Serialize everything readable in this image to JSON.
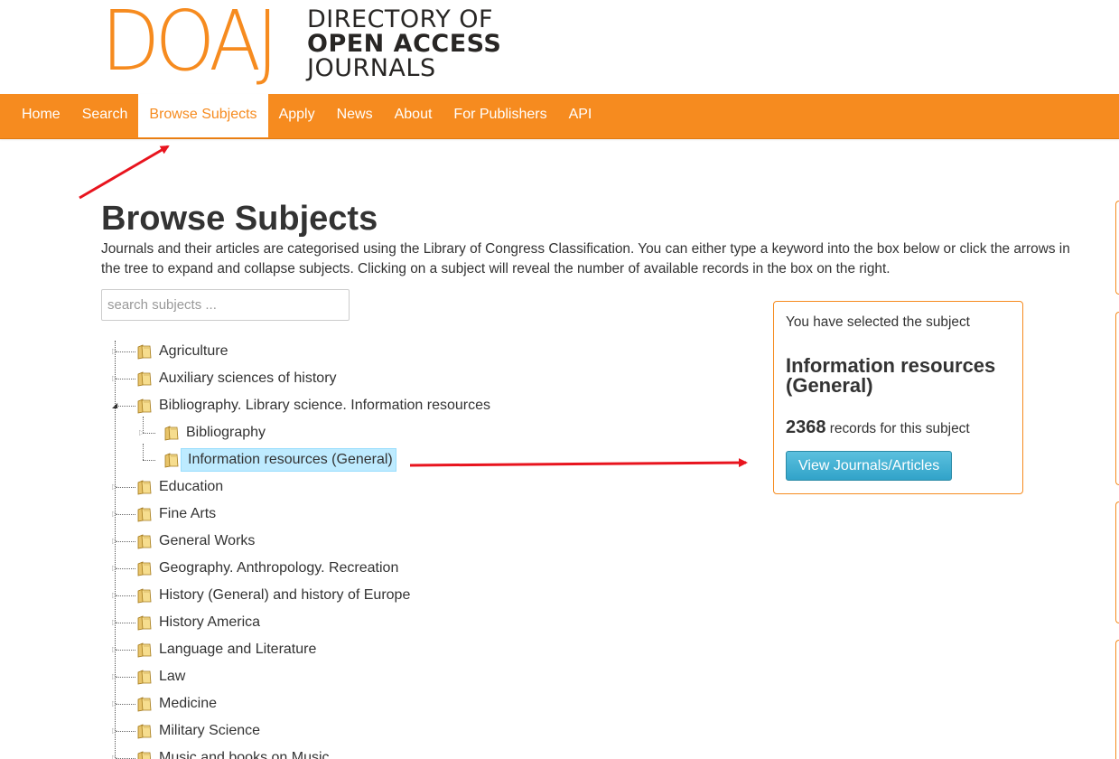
{
  "logo": {
    "letters": "DOAJ",
    "line1": "DIRECTORY OF",
    "line2": "OPEN ACCESS",
    "line3": "JOURNALS"
  },
  "nav": {
    "items": [
      {
        "label": "Home",
        "active": false
      },
      {
        "label": "Search",
        "active": false
      },
      {
        "label": "Browse Subjects",
        "active": true
      },
      {
        "label": "Apply",
        "active": false
      },
      {
        "label": "News",
        "active": false
      },
      {
        "label": "About",
        "active": false
      },
      {
        "label": "For Publishers",
        "active": false
      },
      {
        "label": "API",
        "active": false
      }
    ]
  },
  "page": {
    "title": "Browse Subjects",
    "intro": "Journals and their articles are categorised using the Library of Congress Classification. You can either type a keyword into the box below or click the arrows in the tree to expand and collapse subjects. Clicking on a subject will reveal the number of available records in the box on the right."
  },
  "search": {
    "placeholder": "search subjects ...",
    "value": ""
  },
  "tree": {
    "nodes": [
      {
        "label": "Agriculture",
        "level": 0,
        "toggle": "collapsed"
      },
      {
        "label": "Auxiliary sciences of history",
        "level": 0,
        "toggle": "collapsed"
      },
      {
        "label": "Bibliography. Library science. Information resources",
        "level": 0,
        "toggle": "expanded"
      },
      {
        "label": "Bibliography",
        "level": 1,
        "toggle": "collapsed"
      },
      {
        "label": "Information resources (General)",
        "level": 1,
        "toggle": "none",
        "selected": true
      },
      {
        "label": "Education",
        "level": 0,
        "toggle": "collapsed"
      },
      {
        "label": "Fine Arts",
        "level": 0,
        "toggle": "collapsed"
      },
      {
        "label": "General Works",
        "level": 0,
        "toggle": "collapsed"
      },
      {
        "label": "Geography. Anthropology. Recreation",
        "level": 0,
        "toggle": "collapsed"
      },
      {
        "label": "History (General) and history of Europe",
        "level": 0,
        "toggle": "collapsed"
      },
      {
        "label": "History America",
        "level": 0,
        "toggle": "collapsed"
      },
      {
        "label": "Language and Literature",
        "level": 0,
        "toggle": "collapsed"
      },
      {
        "label": "Law",
        "level": 0,
        "toggle": "collapsed"
      },
      {
        "label": "Medicine",
        "level": 0,
        "toggle": "collapsed"
      },
      {
        "label": "Military Science",
        "level": 0,
        "toggle": "collapsed"
      },
      {
        "label": "Music and books on Music",
        "level": 0,
        "toggle": "collapsed"
      }
    ]
  },
  "info": {
    "intro": "You have selected the subject",
    "subject": "Information resources (General)",
    "count": "2368",
    "count_suffix": " records for this subject",
    "button_label": "View Journals/Articles"
  },
  "colors": {
    "brand_orange": "#f68b1f",
    "selection_bg": "#beebff",
    "button_blue": "#31a3c9",
    "annotation_red": "#e8141e"
  },
  "icons": {
    "tree_node": "folder-icon",
    "annotation": "red-arrow-icon"
  }
}
